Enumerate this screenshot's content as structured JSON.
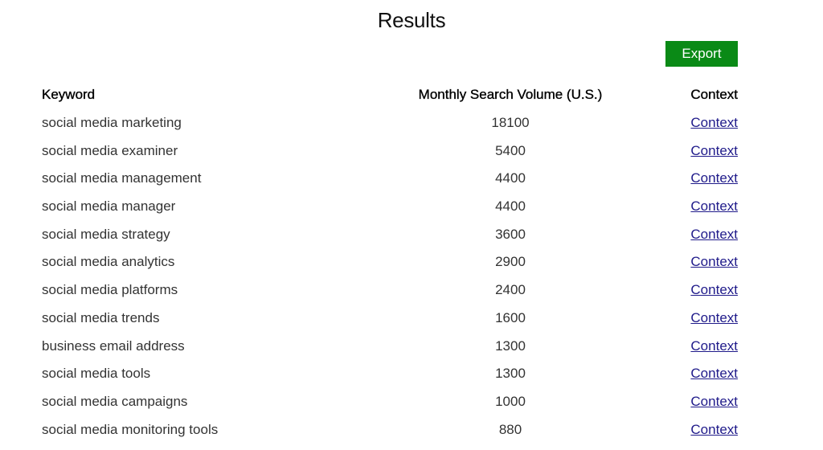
{
  "page": {
    "title": "Results"
  },
  "toolbar": {
    "export_label": "Export",
    "export_color": "#0a8a16"
  },
  "table": {
    "headers": {
      "keyword": "Keyword",
      "volume": "Monthly Search Volume (U.S.)",
      "context": "Context"
    },
    "link_color": "#1f1a8a",
    "rows": [
      {
        "keyword": "social media marketing",
        "volume": "18100",
        "context": "Context"
      },
      {
        "keyword": "social media examiner",
        "volume": "5400",
        "context": "Context"
      },
      {
        "keyword": "social media management",
        "volume": "4400",
        "context": "Context"
      },
      {
        "keyword": "social media manager",
        "volume": "4400",
        "context": "Context"
      },
      {
        "keyword": "social media strategy",
        "volume": "3600",
        "context": "Context"
      },
      {
        "keyword": "social media analytics",
        "volume": "2900",
        "context": "Context"
      },
      {
        "keyword": "social media platforms",
        "volume": "2400",
        "context": "Context"
      },
      {
        "keyword": "social media trends",
        "volume": "1600",
        "context": "Context"
      },
      {
        "keyword": "business email address",
        "volume": "1300",
        "context": "Context"
      },
      {
        "keyword": "social media tools",
        "volume": "1300",
        "context": "Context"
      },
      {
        "keyword": "social media campaigns",
        "volume": "1000",
        "context": "Context"
      },
      {
        "keyword": "social media monitoring tools",
        "volume": "880",
        "context": "Context"
      }
    ]
  }
}
